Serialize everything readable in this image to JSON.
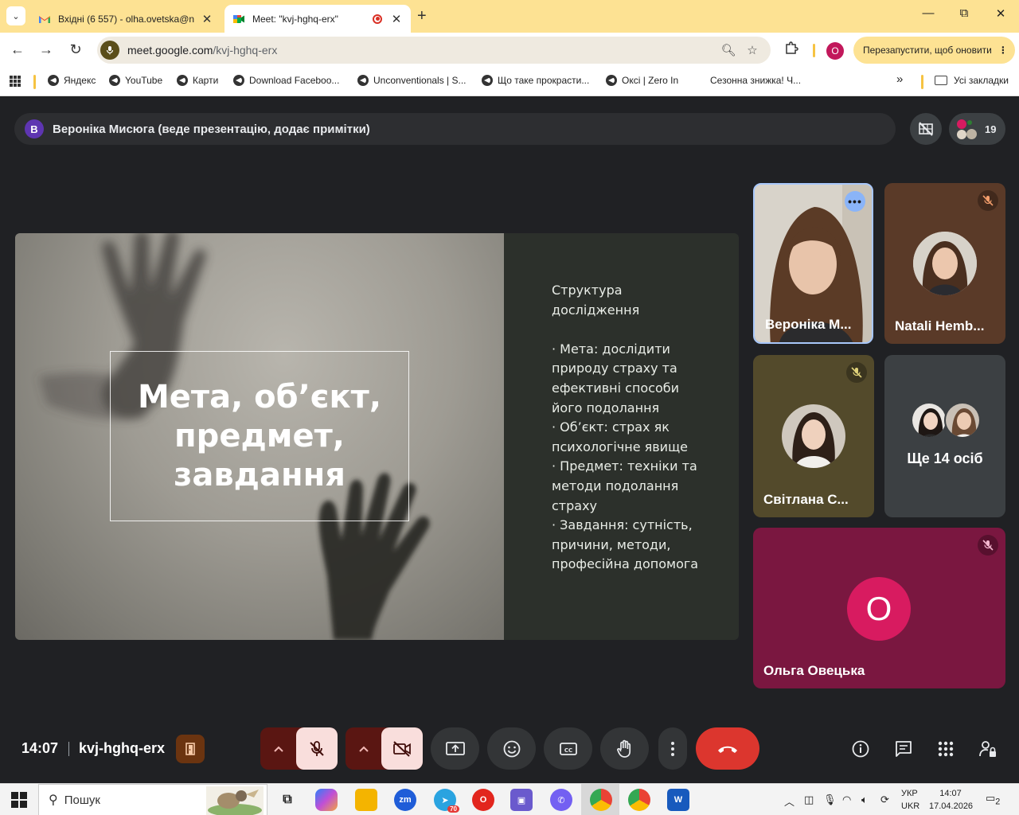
{
  "browser": {
    "tabs": [
      {
        "title": "Вхідні (6 557) - olha.ovetska@n",
        "favicon": "gmail-icon",
        "active": false
      },
      {
        "title": "Meet: \"kvj-hghq-erx\"",
        "favicon": "google-meet-icon",
        "active": true,
        "recording": true
      }
    ],
    "new_tab": "+",
    "window_controls": {
      "minimize": "—",
      "restore": "⧉",
      "close": "✕"
    },
    "url_host": "meet.google.com",
    "url_path": "/kvj-hghq-erx",
    "profile_initial": "O",
    "update_button": "Перезапустити, щоб оновити",
    "update_more": "⋮",
    "bookmarks": [
      "Яндекс",
      "YouTube",
      "Карти",
      "Download Faceboo...",
      "Unconventionals | S...",
      "Що таке прокрасти...",
      "Оксі | Zero In",
      "Сезонна знижка! Ч..."
    ],
    "bookmarks_overflow": "»",
    "all_bookmarks": "Усі закладки"
  },
  "meet": {
    "presenter_initial": "В",
    "presenter_label": "Вероніка Мисюга (веде презентацію, додає примітки)",
    "participant_count": "19",
    "slide": {
      "title": "Мета, об’єкт, предмет, завдання",
      "heading_line1": "Структура",
      "heading_line2": "дослідження",
      "bullets": [
        "· Мета: дослідити природу страху та ефективні способи його подолання",
        "· Об’єкт: страх як психологічне явище",
        "· Предмет: техніки та методи подолання страху",
        "· Завдання: сутність, причини, методи, професійна допомога"
      ]
    },
    "tiles": [
      {
        "name": "Вероніка М...",
        "speaking": true
      },
      {
        "name": "Natali Hemb...",
        "muted": true
      },
      {
        "name": "Світлана С...",
        "muted": true
      },
      {
        "name": "Ще 14 осіб"
      },
      {
        "name": "Ольга Овецька",
        "initial": "О",
        "muted": true
      }
    ],
    "time": "14:07",
    "meeting_code": "kvj-hghq-erx",
    "colors": {
      "hangup": "#dc362e",
      "muted_button": "#f9dedc",
      "accent_tile_border": "#a8c7fa",
      "self_tile": "#7a1740"
    }
  },
  "taskbar": {
    "search_placeholder": "Пошук",
    "telegram_badge": "70",
    "lang_top": "УКР",
    "lang_bottom": "UKR",
    "time": "14:07",
    "date": "17.04.2026",
    "notifications": "2"
  }
}
